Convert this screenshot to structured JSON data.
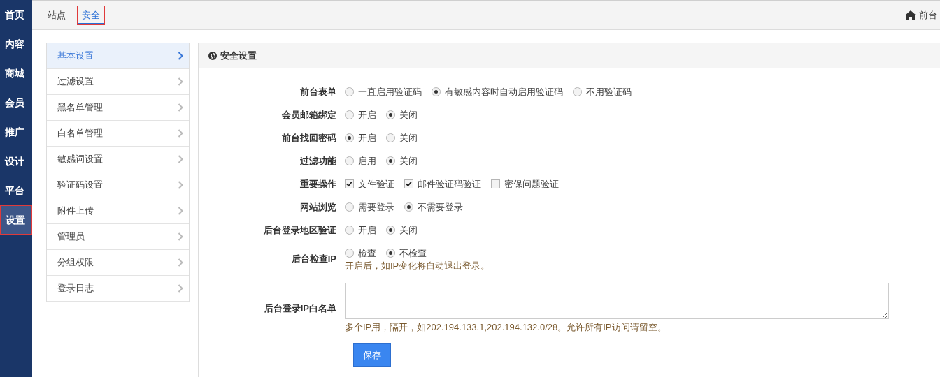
{
  "sidebar": {
    "items": [
      {
        "label": "首页",
        "selected": false
      },
      {
        "label": "内容",
        "selected": false
      },
      {
        "label": "商城",
        "selected": false
      },
      {
        "label": "会员",
        "selected": false
      },
      {
        "label": "推广",
        "selected": false
      },
      {
        "label": "设计",
        "selected": false
      },
      {
        "label": "平台",
        "selected": false
      },
      {
        "label": "设置",
        "selected": true
      }
    ]
  },
  "tabs": [
    {
      "label": "站点",
      "selected": false
    },
    {
      "label": "安全",
      "selected": true
    }
  ],
  "frontend_link": "前台",
  "submenu": [
    {
      "label": "基本设置",
      "selected": true
    },
    {
      "label": "过滤设置",
      "selected": false
    },
    {
      "label": "黑名单管理",
      "selected": false
    },
    {
      "label": "白名单管理",
      "selected": false
    },
    {
      "label": "敏感词设置",
      "selected": false
    },
    {
      "label": "验证码设置",
      "selected": false
    },
    {
      "label": "附件上传",
      "selected": false
    },
    {
      "label": "管理员",
      "selected": false
    },
    {
      "label": "分组权限",
      "selected": false
    },
    {
      "label": "登录日志",
      "selected": false
    }
  ],
  "panel": {
    "title": "安全设置",
    "fields": [
      {
        "kind": "radio",
        "label": "前台表单",
        "options": [
          {
            "label": "一直启用验证码",
            "selected": false
          },
          {
            "label": "有敏感内容时自动启用验证码",
            "selected": true
          },
          {
            "label": "不用验证码",
            "selected": false
          }
        ]
      },
      {
        "kind": "radio",
        "label": "会员邮箱绑定",
        "options": [
          {
            "label": "开启",
            "selected": false
          },
          {
            "label": "关闭",
            "selected": true
          }
        ]
      },
      {
        "kind": "radio",
        "label": "前台找回密码",
        "options": [
          {
            "label": "开启",
            "selected": true
          },
          {
            "label": "关闭",
            "selected": false
          }
        ]
      },
      {
        "kind": "radio",
        "label": "过滤功能",
        "options": [
          {
            "label": "启用",
            "selected": false
          },
          {
            "label": "关闭",
            "selected": true
          }
        ]
      },
      {
        "kind": "checkbox",
        "label": "重要操作",
        "options": [
          {
            "label": "文件验证",
            "checked": true
          },
          {
            "label": "邮件验证码验证",
            "checked": true
          },
          {
            "label": "密保问题验证",
            "checked": false
          }
        ]
      },
      {
        "kind": "radio",
        "label": "网站浏览",
        "options": [
          {
            "label": "需要登录",
            "selected": false
          },
          {
            "label": "不需要登录",
            "selected": true
          }
        ]
      },
      {
        "kind": "radio",
        "label": "后台登录地区验证",
        "options": [
          {
            "label": "开启",
            "selected": false
          },
          {
            "label": "关闭",
            "selected": true
          }
        ]
      },
      {
        "kind": "radio",
        "label": "后台检查IP",
        "options": [
          {
            "label": "检查",
            "selected": false
          },
          {
            "label": "不检查",
            "selected": true
          }
        ],
        "help": "开启后，如IP变化将自动退出登录。"
      },
      {
        "kind": "textarea",
        "label": "后台登录IP白名单",
        "help": "多个IP用，隔开，如202.194.133.1,202.194.132.0/28。允许所有IP访问请留空。"
      }
    ],
    "save_button": "保存"
  }
}
